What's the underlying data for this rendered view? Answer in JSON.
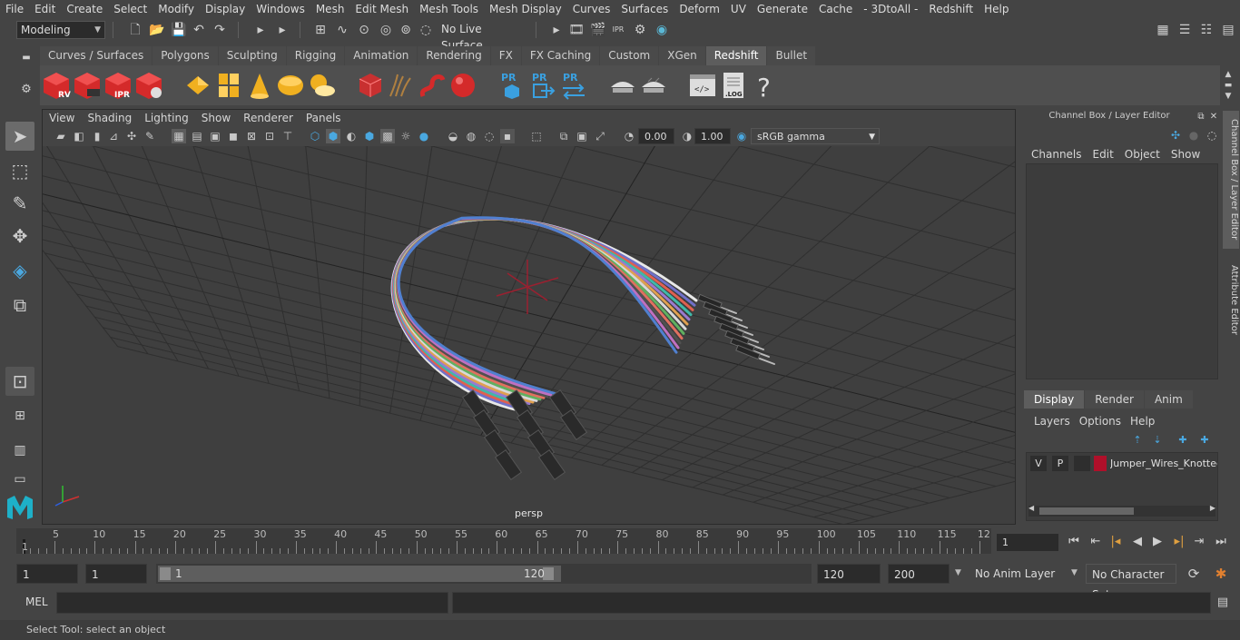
{
  "menus": [
    "File",
    "Edit",
    "Create",
    "Select",
    "Modify",
    "Display",
    "Windows",
    "Mesh",
    "Edit Mesh",
    "Mesh Tools",
    "Mesh Display",
    "Curves",
    "Surfaces",
    "Deform",
    "UV",
    "Generate",
    "Cache",
    "- 3DtoAll -",
    "Redshift",
    "Help"
  ],
  "statusline": {
    "mode": "Modeling",
    "live_surface": "No Live Surface"
  },
  "shelf_tabs": [
    "Curves / Surfaces",
    "Polygons",
    "Sculpting",
    "Rigging",
    "Animation",
    "Rendering",
    "FX",
    "FX Caching",
    "Custom",
    "XGen",
    "Redshift",
    "Bullet"
  ],
  "shelf_active_tab": "Redshift",
  "shelf_labels": {
    "rv": "RV",
    "ipr": "IPR",
    "pr1": "PR",
    "pr2": "PR",
    "pr3": "PR",
    "log": ".LOG",
    "help": "?"
  },
  "viewport": {
    "menus": [
      "View",
      "Shading",
      "Lighting",
      "Show",
      "Renderer",
      "Panels"
    ],
    "exposure": "0.00",
    "gamma": "1.00",
    "color_space": "sRGB gamma",
    "camera": "persp"
  },
  "channel_box": {
    "title": "Channel Box / Layer Editor",
    "menus": [
      "Channels",
      "Edit",
      "Object",
      "Show"
    ],
    "layer_tabs": [
      "Display",
      "Render",
      "Anim"
    ],
    "layer_menus": [
      "Layers",
      "Options",
      "Help"
    ],
    "layer": {
      "v": "V",
      "p": "P",
      "name": "Jumper_Wires_Knotted",
      "color": "#b0102a"
    }
  },
  "side_tabs": [
    "Channel Box / Layer Editor",
    "Attribute Editor"
  ],
  "timeline": {
    "ticks": [
      "5",
      "10",
      "15",
      "20",
      "25",
      "30",
      "35",
      "40",
      "45",
      "50",
      "55",
      "60",
      "65",
      "70",
      "75",
      "80",
      "85",
      "90",
      "95",
      "100",
      "105",
      "110",
      "115",
      "12"
    ],
    "start_tick": "1",
    "current_frame": "1"
  },
  "range": {
    "start": "1",
    "playback_start": "1",
    "slider_start": "1",
    "slider_end": "120",
    "playback_end": "120",
    "end": "200",
    "anim_layer": "No Anim Layer",
    "character_set": "No Character Set"
  },
  "command_line": {
    "label": "MEL"
  },
  "help_line": "Select Tool: select an object",
  "colors": {
    "accent": "#5d5d5d",
    "redshift": "#e03030",
    "wire_selected": "#b0102a"
  }
}
